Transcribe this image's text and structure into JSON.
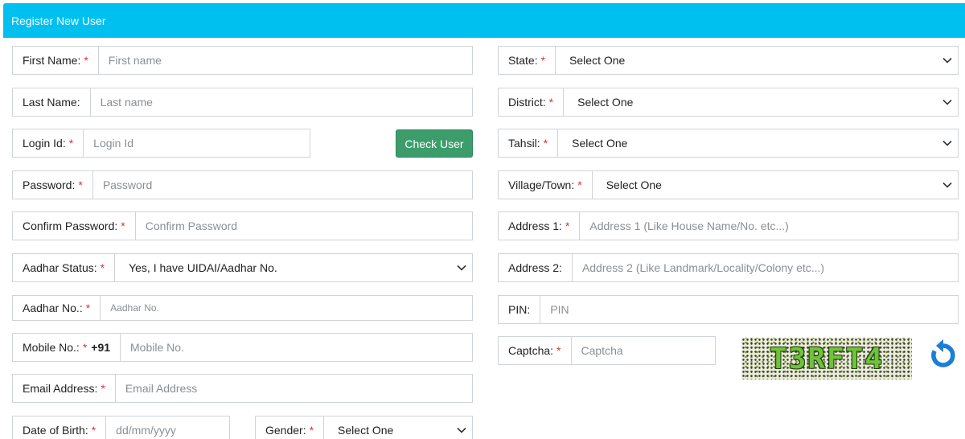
{
  "header": {
    "title": "Register New User"
  },
  "required_mark": "*",
  "left": {
    "first_name": {
      "label": "First Name:",
      "placeholder": "First name"
    },
    "last_name": {
      "label": "Last Name:",
      "placeholder": "Last name"
    },
    "login_id": {
      "label": "Login Id:",
      "placeholder": "Login Id"
    },
    "check_user_button": "Check User",
    "password": {
      "label": "Password:",
      "placeholder": "Password"
    },
    "confirm_password": {
      "label": "Confirm Password:",
      "placeholder": "Confirm Password"
    },
    "aadhar_status": {
      "label": "Aadhar Status:",
      "value": "Yes, I have UIDAI/Aadhar No."
    },
    "aadhar_no": {
      "label": "Aadhar No.:",
      "placeholder": "Aadhar No."
    },
    "mobile_no": {
      "label": "Mobile No.:",
      "prefix": "+91",
      "placeholder": "Mobile No."
    },
    "email": {
      "label": "Email Address:",
      "placeholder": "Email Address"
    },
    "dob": {
      "label": "Date of Birth:",
      "placeholder": "dd/mm/yyyy"
    },
    "gender": {
      "label": "Gender:",
      "value": "Select One"
    }
  },
  "right": {
    "state": {
      "label": "State:",
      "value": "Select One"
    },
    "district": {
      "label": "District:",
      "value": "Select One"
    },
    "tahsil": {
      "label": "Tahsil:",
      "value": "Select One"
    },
    "village": {
      "label": "Village/Town:",
      "value": "Select One"
    },
    "address1": {
      "label": "Address 1:",
      "placeholder": "Address 1 (Like House Name/No. etc...)"
    },
    "address2": {
      "label": "Address 2:",
      "placeholder": "Address 2 (Like Landmark/Locality/Colony etc...)"
    },
    "pin": {
      "label": "PIN:",
      "placeholder": "PIN"
    },
    "captcha": {
      "label": "Captcha:",
      "placeholder": "Captcha",
      "image_text": "T3RFT4"
    }
  },
  "icons": {
    "refresh": "refresh-icon",
    "chevron": "chevron-down-icon"
  },
  "colors": {
    "header": "#00c0ef",
    "check_button": "#3c9d6b",
    "required": "#dd3333",
    "refresh": "#1a7fd4"
  }
}
